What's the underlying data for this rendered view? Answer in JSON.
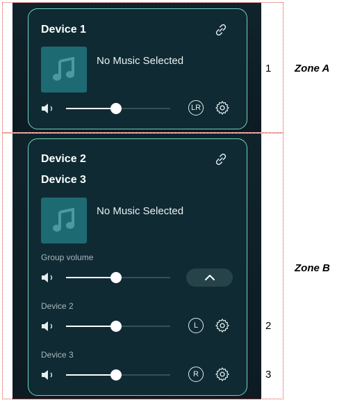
{
  "zones": [
    {
      "label": "Zone A"
    },
    {
      "label": "Zone B"
    }
  ],
  "markers": [
    "1",
    "2",
    "3"
  ],
  "zone_a": {
    "device_title": "Device 1",
    "now_playing": "No Music Selected",
    "volume": 0.48,
    "channel": "LR",
    "icons": {
      "link": "link-icon",
      "settings": "gear-icon",
      "volume": "speaker-icon",
      "art": "music-note-icon"
    }
  },
  "zone_b": {
    "device_titles": [
      "Device 2",
      "Device 3"
    ],
    "now_playing": "No Music Selected",
    "group_volume_label": "Group volume",
    "group_volume": 0.48,
    "devices": [
      {
        "name": "Device 2",
        "volume": 0.48,
        "channel": "L"
      },
      {
        "name": "Device 3",
        "volume": 0.48,
        "channel": "R"
      }
    ],
    "icons": {
      "link": "link-icon",
      "settings": "gear-icon",
      "volume": "speaker-icon",
      "art": "music-note-icon",
      "collapse": "chevron-up-icon"
    }
  },
  "colors": {
    "accent": "#6fd6c4",
    "card": "#0f2a33",
    "art": "#1e6a73",
    "annotation": "#d9473a"
  }
}
